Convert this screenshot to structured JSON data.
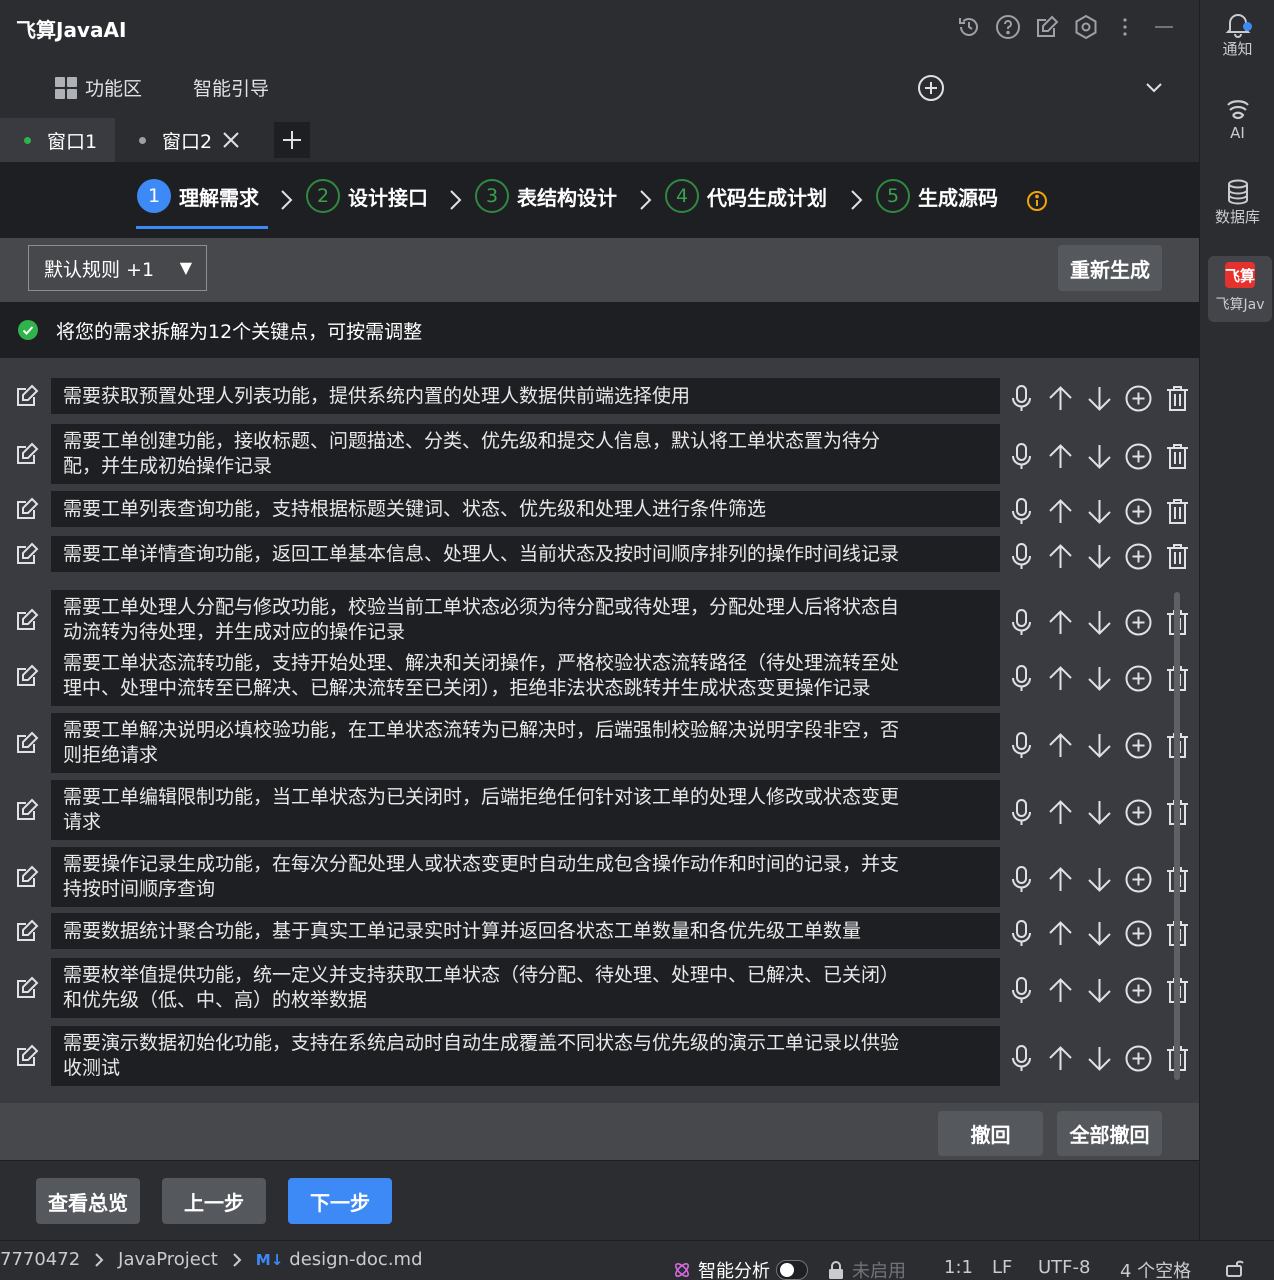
{
  "app": {
    "title": "飞算JavaAI",
    "func_area": "功能区",
    "smart_guide": "智能引导"
  },
  "window_tabs": [
    {
      "label": "窗口1",
      "dot_color": "#2fb34a"
    },
    {
      "label": "窗口2",
      "dot_color": "#9ca0a6"
    }
  ],
  "steps": [
    {
      "num": "1",
      "label": "理解需求"
    },
    {
      "num": "2",
      "label": "设计接口"
    },
    {
      "num": "3",
      "label": "表结构设计"
    },
    {
      "num": "4",
      "label": "代码生成计划"
    },
    {
      "num": "5",
      "label": "生成源码"
    }
  ],
  "rule_select": {
    "value": "默认规则 +1"
  },
  "regenerate_label": "重新生成",
  "summary_text": "将您的需求拆解为12个关键点，可按需调整",
  "requirements": [
    {
      "lines": [
        "需要获取预置处理人列表功能，提供系统内置的处理人数据供前端选择使用"
      ]
    },
    {
      "lines": [
        "需要工单创建功能，接收标题、问题描述、分类、优先级和提交人信息，默认将工单状态置为待分",
        "配，并生成初始操作记录"
      ]
    },
    {
      "lines": [
        "需要工单列表查询功能，支持根据标题关键词、状态、优先级和处理人进行条件筛选"
      ]
    },
    {
      "lines": [
        "需要工单详情查询功能，返回工单基本信息、处理人、当前状态及按时间顺序排列的操作时间线记录"
      ]
    },
    {
      "lines": [
        "需要工单处理人分配与修改功能，校验当前工单状态必须为待分配或待处理，分配处理人后将状态自",
        "动流转为待处理，并生成对应的操作记录"
      ]
    },
    {
      "lines": [
        "需要工单状态流转功能，支持开始处理、解决和关闭操作，严格校验状态流转路径（待处理流转至处",
        "理中、处理中流转至已解决、已解决流转至已关闭），拒绝非法状态跳转并生成状态变更操作记录"
      ]
    },
    {
      "lines": [
        "需要工单解决说明必填校验功能，在工单状态流转为已解决时，后端强制校验解决说明字段非空，否",
        "则拒绝请求"
      ]
    },
    {
      "lines": [
        "需要工单编辑限制功能，当工单状态为已关闭时，后端拒绝任何针对该工单的处理人修改或状态变更",
        "请求"
      ]
    },
    {
      "lines": [
        "需要操作记录生成功能，在每次分配处理人或状态变更时自动生成包含操作动作和时间的记录，并支",
        "持按时间顺序查询"
      ]
    },
    {
      "lines": [
        "需要数据统计聚合功能，基于真实工单记录实时计算并返回各状态工单数量和各优先级工单数量"
      ]
    },
    {
      "lines": [
        "需要枚举值提供功能，统一定义并支持获取工单状态（待分配、待处理、处理中、已解决、已关闭）",
        "和优先级（低、中、高）的枚举数据"
      ]
    },
    {
      "lines": [
        "需要演示数据初始化功能，支持在系统启动时自动生成覆盖不同状态与优先级的演示工单记录以供验",
        "收测试"
      ]
    }
  ],
  "buttons": {
    "undo": "撤回",
    "undo_all": "全部撤回",
    "overview": "查看总览",
    "prev": "上一步",
    "next": "下一步"
  },
  "right_strip": {
    "notify": "通知",
    "ai": "AI",
    "database": "数据库",
    "feisuan_logo": "飞算",
    "feisuan": "飞算Jav"
  },
  "statusbar": {
    "path_num": "7770472",
    "project": "JavaProject",
    "md_badge": "M↓",
    "file": "design-doc.md",
    "smart_analysis": "智能分析",
    "disabled": "未启用",
    "position": "1:1",
    "line_ending": "LF",
    "encoding": "UTF-8",
    "indent": "4 个空格"
  },
  "colors": {
    "accent": "#3d8af7",
    "step_pending": "#2f8a40",
    "info": "#f0a30a",
    "success": "#2fb34a",
    "logo_red": "#e5322d"
  }
}
